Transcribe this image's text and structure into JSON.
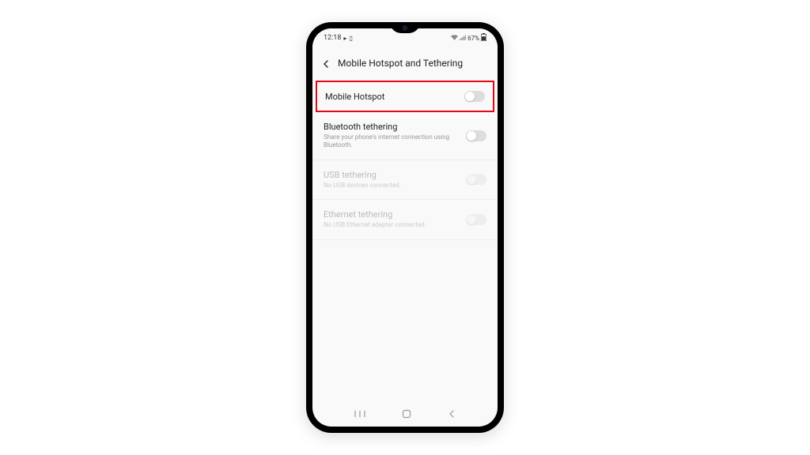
{
  "statusBar": {
    "time": "12:18",
    "battery": "67%"
  },
  "header": {
    "title": "Mobile Hotspot and Tethering"
  },
  "settings": [
    {
      "title": "Mobile Hotspot",
      "subtitle": "",
      "enabled": true,
      "highlighted": true
    },
    {
      "title": "Bluetooth tethering",
      "subtitle": "Share your phone's internet connection using Bluetooth.",
      "enabled": true,
      "highlighted": false
    },
    {
      "title": "USB tethering",
      "subtitle": "No USB devices connected.",
      "enabled": false,
      "highlighted": false
    },
    {
      "title": "Ethernet tethering",
      "subtitle": "No USB Ethernet adapter connected.",
      "enabled": false,
      "highlighted": false
    }
  ]
}
